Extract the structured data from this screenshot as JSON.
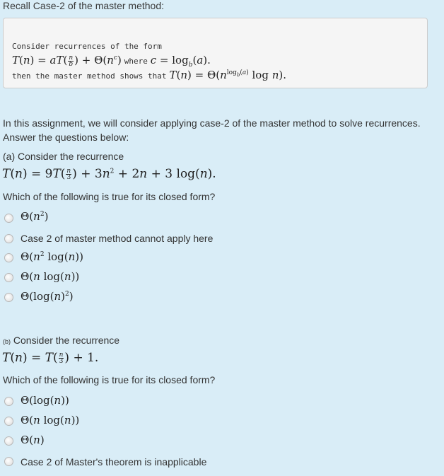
{
  "recall": {
    "title": "Recall Case-2 of the master method:",
    "box_line1": "Consider recurrences of the form",
    "box_line2_math": "T(n) = aT(n/b) + Θ(n^c)",
    "box_line2_where": "where",
    "box_line2_math2": "c = log_b(a).",
    "box_line3_text": "then the master method shows that",
    "box_line3_math": "T(n) = Θ(n^{log_b(a)} log n)."
  },
  "intro": {
    "line1": "In this assignment, we will consider applying case-2 of the master method to solve recurrences.",
    "line2": "Answer the questions below:"
  },
  "question_a": {
    "label": "(a) Consider the recurrence",
    "recurrence": "T(n) = 9T(n/3) + 3n² + 2n + 3log(n).",
    "prompt": "Which of the following is true for its closed form?",
    "options": [
      {
        "label": "Θ(n²)",
        "selected": false
      },
      {
        "label": "Case 2 of master method cannot apply here",
        "selected": false
      },
      {
        "label": "Θ(n² log(n))",
        "selected": false
      },
      {
        "label": "Θ(n log(n))",
        "selected": false
      },
      {
        "label": "Θ(log(n)²)",
        "selected": false
      }
    ]
  },
  "question_b": {
    "label_prefix": "(b)",
    "label": "Consider the recurrence",
    "recurrence": "T(n) = T(n/3) + 1.",
    "prompt": "Which of the following is true for its closed form?",
    "options": [
      {
        "label": "Θ(log(n))",
        "selected": false
      },
      {
        "label": "Θ(n log(n))",
        "selected": false
      },
      {
        "label": "Θ(n)",
        "selected": false
      },
      {
        "label": "Case 2 of Master's theorem is inapplicable",
        "selected": false
      }
    ]
  }
}
